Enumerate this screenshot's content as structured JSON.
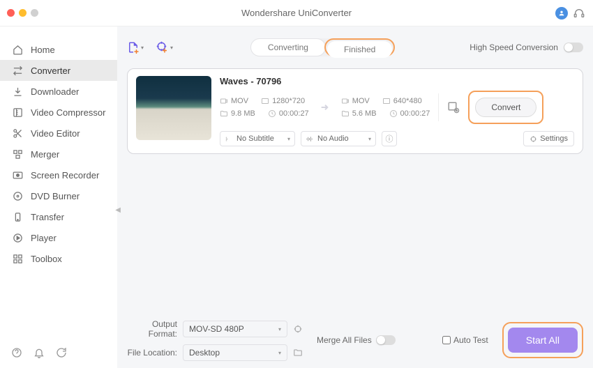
{
  "app_title": "Wondershare UniConverter",
  "sidebar": {
    "items": [
      {
        "label": "Home"
      },
      {
        "label": "Converter"
      },
      {
        "label": "Downloader"
      },
      {
        "label": "Video Compressor"
      },
      {
        "label": "Video Editor"
      },
      {
        "label": "Merger"
      },
      {
        "label": "Screen Recorder"
      },
      {
        "label": "DVD Burner"
      },
      {
        "label": "Transfer"
      },
      {
        "label": "Player"
      },
      {
        "label": "Toolbox"
      }
    ]
  },
  "toolbar": {
    "tab_converting": "Converting",
    "tab_finished": "Finished",
    "high_speed_label": "High Speed Conversion"
  },
  "card": {
    "title": "Waves - 70796",
    "source": {
      "format": "MOV",
      "resolution": "1280*720",
      "size": "9.8 MB",
      "duration": "00:00:27"
    },
    "target": {
      "format": "MOV",
      "resolution": "640*480",
      "size": "5.6 MB",
      "duration": "00:00:27"
    },
    "subtitle_sel": "No Subtitle",
    "audio_sel": "No Audio",
    "settings_label": "Settings",
    "convert_label": "Convert"
  },
  "bottom": {
    "output_format_label": "Output Format:",
    "output_format_value": "MOV-SD 480P",
    "file_location_label": "File Location:",
    "file_location_value": "Desktop",
    "merge_label": "Merge All Files",
    "auto_test_label": "Auto Test",
    "start_label": "Start All"
  }
}
